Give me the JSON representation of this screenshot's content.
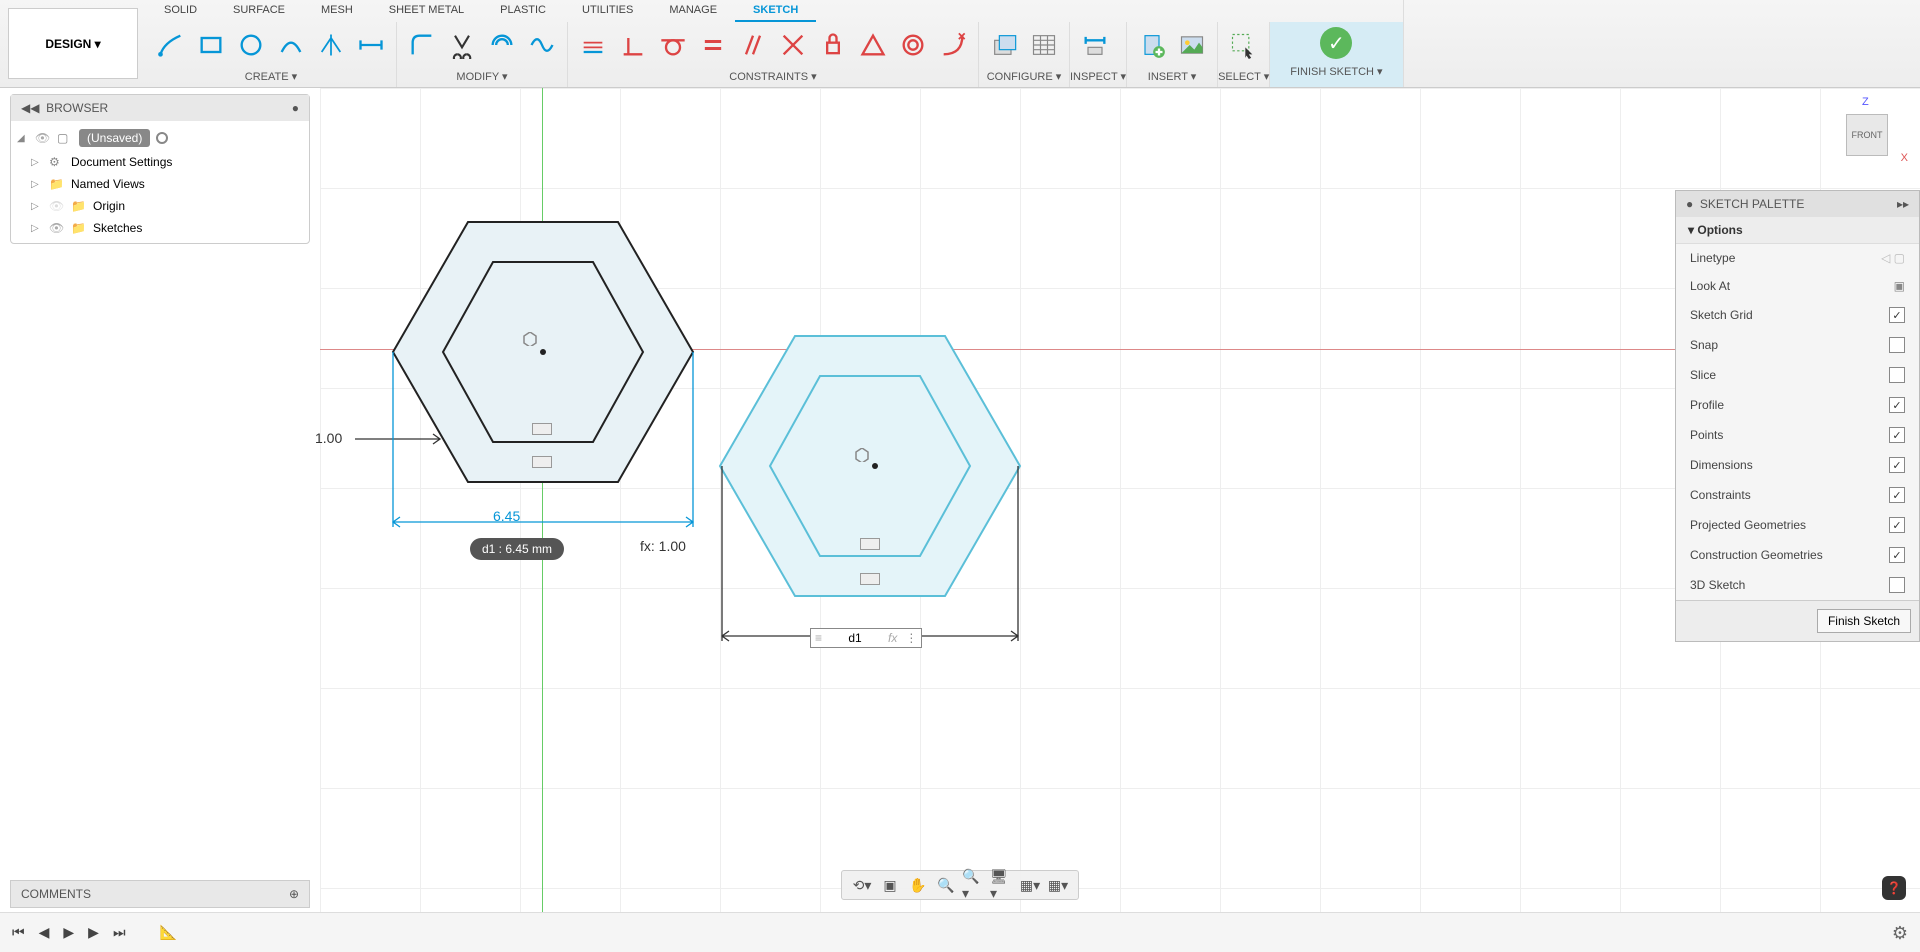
{
  "workspace_button": "DESIGN ▾",
  "tabs": [
    "SOLID",
    "SURFACE",
    "MESH",
    "SHEET METAL",
    "PLASTIC",
    "UTILITIES",
    "MANAGE",
    "SKETCH"
  ],
  "active_tab": "SKETCH",
  "ribbon_labels": {
    "create": "CREATE ▾",
    "modify": "MODIFY ▾",
    "constraints": "CONSTRAINTS ▾",
    "configure": "CONFIGURE ▾",
    "inspect": "INSPECT ▾",
    "insert": "INSERT ▾",
    "select": "SELECT ▾",
    "finish": "FINISH SKETCH ▾"
  },
  "browser": {
    "title": "BROWSER",
    "root": "(Unsaved)",
    "items": [
      "Document Settings",
      "Named Views",
      "Origin",
      "Sketches"
    ]
  },
  "viewcube": {
    "face": "FRONT",
    "axis_z": "Z",
    "axis_x": "X"
  },
  "sketch": {
    "dim_offset": "1.00",
    "dim_width": "6.45",
    "dim_tooltip": "d1 : 6.45 mm",
    "fx_label": "fx: 1.00",
    "input_value": "d1",
    "input_fx": "fx"
  },
  "palette": {
    "title": "SKETCH PALETTE",
    "section": "Options",
    "rows": [
      {
        "label": "Linetype",
        "type": "icons"
      },
      {
        "label": "Look At",
        "type": "icon"
      },
      {
        "label": "Sketch Grid",
        "type": "check",
        "checked": true
      },
      {
        "label": "Snap",
        "type": "check",
        "checked": false
      },
      {
        "label": "Slice",
        "type": "check",
        "checked": false
      },
      {
        "label": "Profile",
        "type": "check",
        "checked": true
      },
      {
        "label": "Points",
        "type": "check",
        "checked": true
      },
      {
        "label": "Dimensions",
        "type": "check",
        "checked": true
      },
      {
        "label": "Constraints",
        "type": "check",
        "checked": true
      },
      {
        "label": "Projected Geometries",
        "type": "check",
        "checked": true
      },
      {
        "label": "Construction Geometries",
        "type": "check",
        "checked": true
      },
      {
        "label": "3D Sketch",
        "type": "check",
        "checked": false
      }
    ],
    "finish_button": "Finish Sketch"
  },
  "comments": "COMMENTS",
  "colors": {
    "accent": "#0696d7",
    "sketch_blue": "#5bbfd8",
    "success": "#5cb85c"
  }
}
